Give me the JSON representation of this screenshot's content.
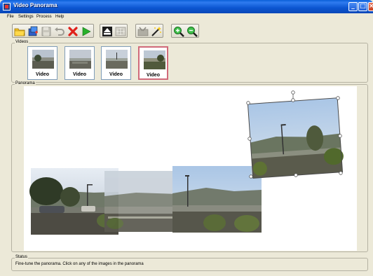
{
  "window": {
    "title": "Video Panorama"
  },
  "menu": {
    "items": [
      "File",
      "Settings",
      "Process",
      "Help"
    ]
  },
  "toolbar": {
    "buttons": [
      "open-folder-icon",
      "add-icon",
      "save-icon",
      "undo-icon",
      "delete-icon",
      "play-icon",
      "eject-icon",
      "frame-icon",
      "tools-icon",
      "wand-icon",
      "zoom-in-icon",
      "zoom-out-icon"
    ]
  },
  "videos": {
    "label": "Videos",
    "items": [
      {
        "caption": "Video",
        "selected": false
      },
      {
        "caption": "Video",
        "selected": false
      },
      {
        "caption": "Video",
        "selected": false
      },
      {
        "caption": "Video",
        "selected": true
      }
    ]
  },
  "panorama": {
    "label": "Panorama"
  },
  "status": {
    "label": "Status",
    "text": "Fine-tune the panorama. Click on any of the images in the panorama"
  },
  "colors": {
    "titlebar": "#0a55d0",
    "selection_border": "#d06a7a",
    "chrome": "#ece9d8"
  }
}
